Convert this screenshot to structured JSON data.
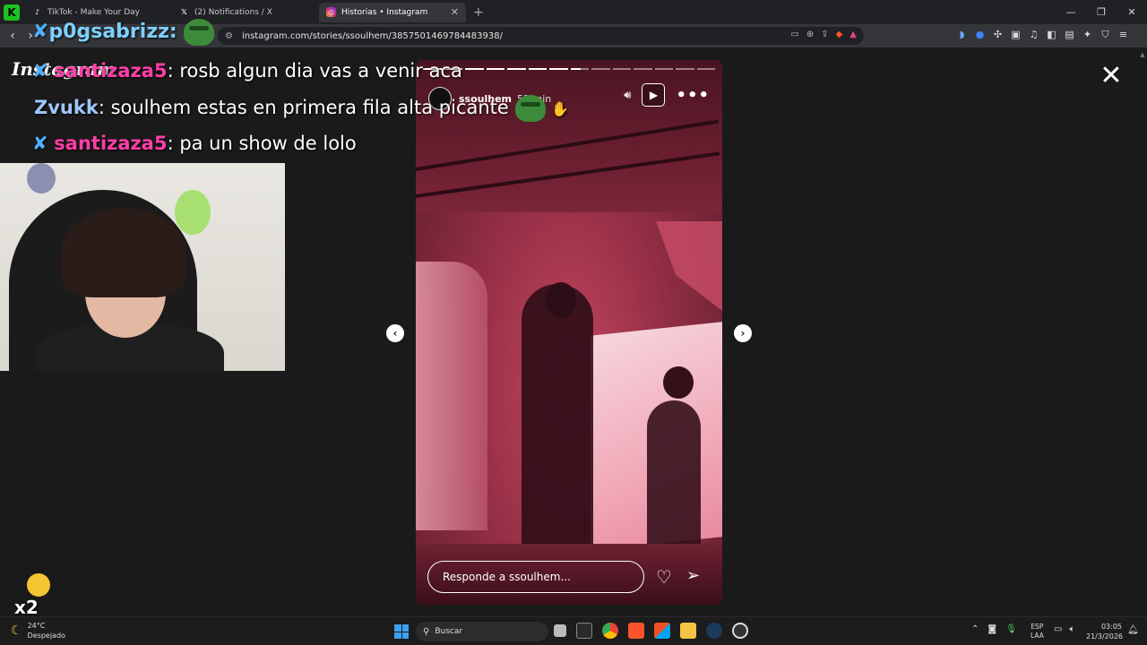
{
  "browser": {
    "app_badge": "K",
    "tabs": [
      {
        "label": "TikTok - Make Your Day",
        "favicon": "tiktok-icon",
        "active": false
      },
      {
        "label": "(2) Notifications / X",
        "favicon": "x-icon",
        "active": false
      },
      {
        "label": "Historias • Instagram",
        "favicon": "instagram-icon",
        "active": true,
        "close": "✕"
      }
    ],
    "new_tab": "+",
    "window_controls": [
      "—",
      "❐",
      "✕"
    ],
    "url": "instagram.com/stories/ssoulhem/3857501469784483938/"
  },
  "instagram": {
    "logo": "Instagram",
    "close": "✕",
    "story": {
      "username": "ssoulhem",
      "time_ago": "51 min",
      "reply_placeholder": "Responde a ssoulhem...",
      "progress": {
        "segments": 14,
        "completed": 7,
        "current_fraction": 0.55
      }
    },
    "prev_arrow": "‹",
    "next_arrow": "›"
  },
  "chat": {
    "top_user": "p0gsabrizz:",
    "lines": [
      {
        "user": "santizaza5",
        "text": ": rosb algun dia vas a venir aca",
        "color": "#ff3ea8"
      },
      {
        "user": "Zvukk",
        "text": ": soulhem estas en primera fila alta picante",
        "color": "#9ec6ff"
      },
      {
        "user": "santizaza5",
        "text": ": pa un show de lolo",
        "color": "#ff3ea8"
      }
    ],
    "emote_multiplier": "x2"
  },
  "taskbar": {
    "weather_temp": "24°C",
    "weather_desc": "Despejado",
    "search_placeholder": "Buscar",
    "lang_top": "ESP",
    "lang_bottom": "LAA",
    "time": "03:05",
    "date": "21/3/2026"
  },
  "colors": {
    "accent": "#4fb0ff",
    "story_tint": "#c24760"
  }
}
